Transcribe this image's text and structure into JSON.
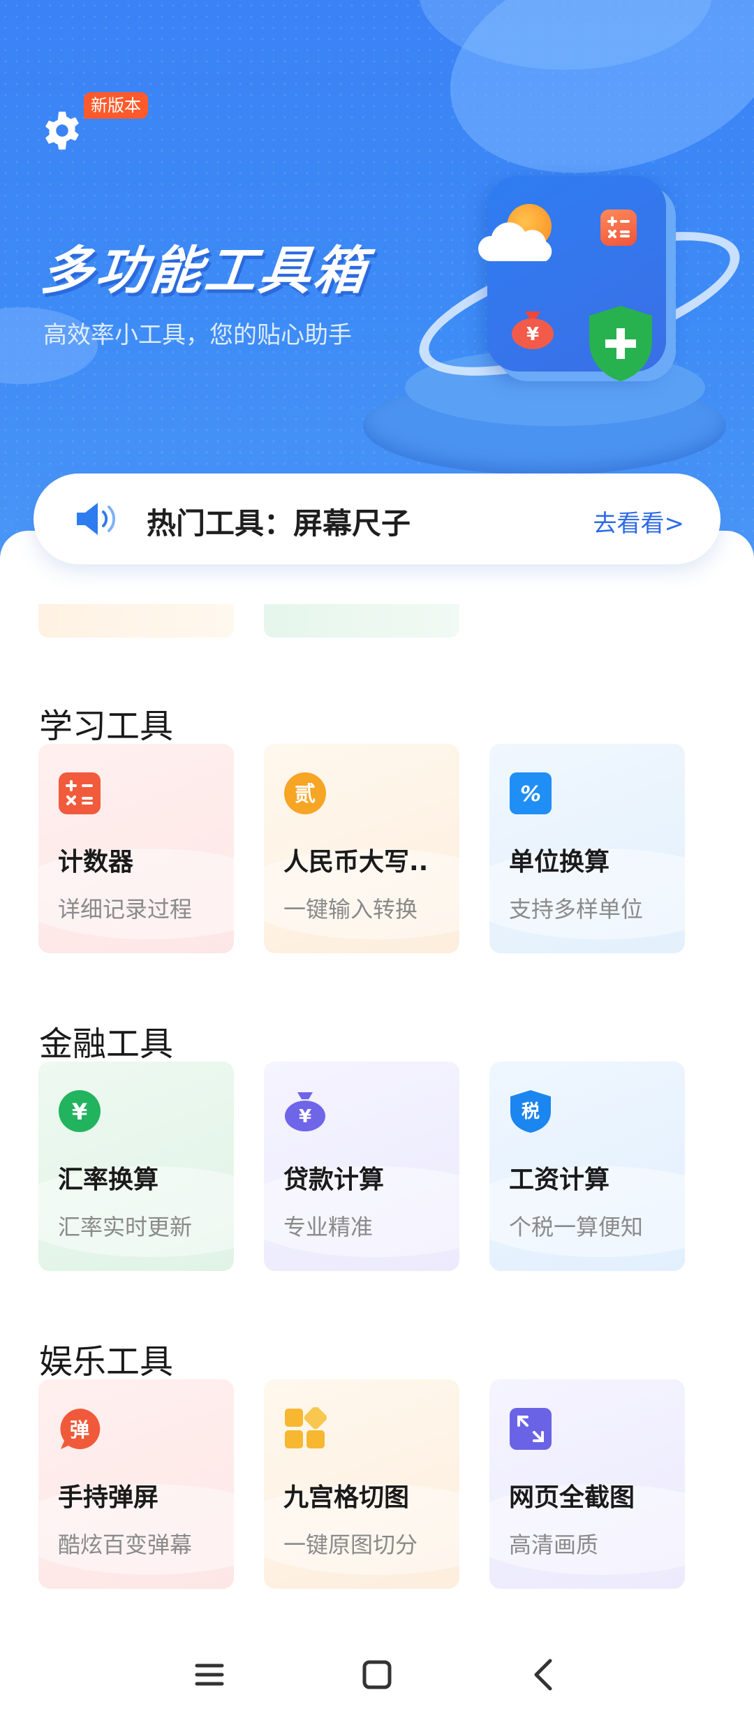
{
  "header": {
    "new_badge": "新版本",
    "title": "多功能工具箱",
    "subtitle": "高效率小工具，您的贴心助手"
  },
  "announcement": {
    "text": "热门工具：屏幕尺子",
    "link": "去看看>"
  },
  "sections": [
    {
      "title": "学习工具",
      "cards": [
        {
          "name": "计数器",
          "desc": "详细记录过程",
          "icon": "calculator-icon",
          "color": "#f25a3c"
        },
        {
          "name": "人民币大写..",
          "desc": "一键输入转换",
          "icon": "yuan-uppercase-icon",
          "icon_text": "贰",
          "color": "#f7a524"
        },
        {
          "name": "单位换算",
          "desc": "支持多样单位",
          "icon": "percent-icon",
          "icon_text": "%",
          "color": "#1f8ef5"
        }
      ]
    },
    {
      "title": "金融工具",
      "cards": [
        {
          "name": "汇率换算",
          "desc": "汇率实时更新",
          "icon": "yuan-exchange-icon",
          "icon_text": "¥",
          "color": "#22b35e"
        },
        {
          "name": "贷款计算",
          "desc": "专业精准",
          "icon": "money-bag-icon",
          "icon_text": "¥",
          "color": "#6f65e8"
        },
        {
          "name": "工资计算",
          "desc": "个税一算便知",
          "icon": "tax-shield-icon",
          "icon_text": "税",
          "color": "#1b86f0"
        }
      ]
    },
    {
      "title": "娱乐工具",
      "cards": [
        {
          "name": "手持弹屏",
          "desc": "酷炫百变弹幕",
          "icon": "danmaku-icon",
          "icon_text": "弹",
          "color": "#f05a3a"
        },
        {
          "name": "九宫格切图",
          "desc": "一键原图切分",
          "icon": "grid-icon",
          "color": "#f7b731"
        },
        {
          "name": "网页全截图",
          "desc": "高清画质",
          "icon": "fullscreen-capture-icon",
          "color": "#6a63e6"
        }
      ]
    }
  ],
  "colors": {
    "primary": "#3b82f6",
    "accent": "#2e6ae8",
    "badge": "#ff5a2c"
  }
}
